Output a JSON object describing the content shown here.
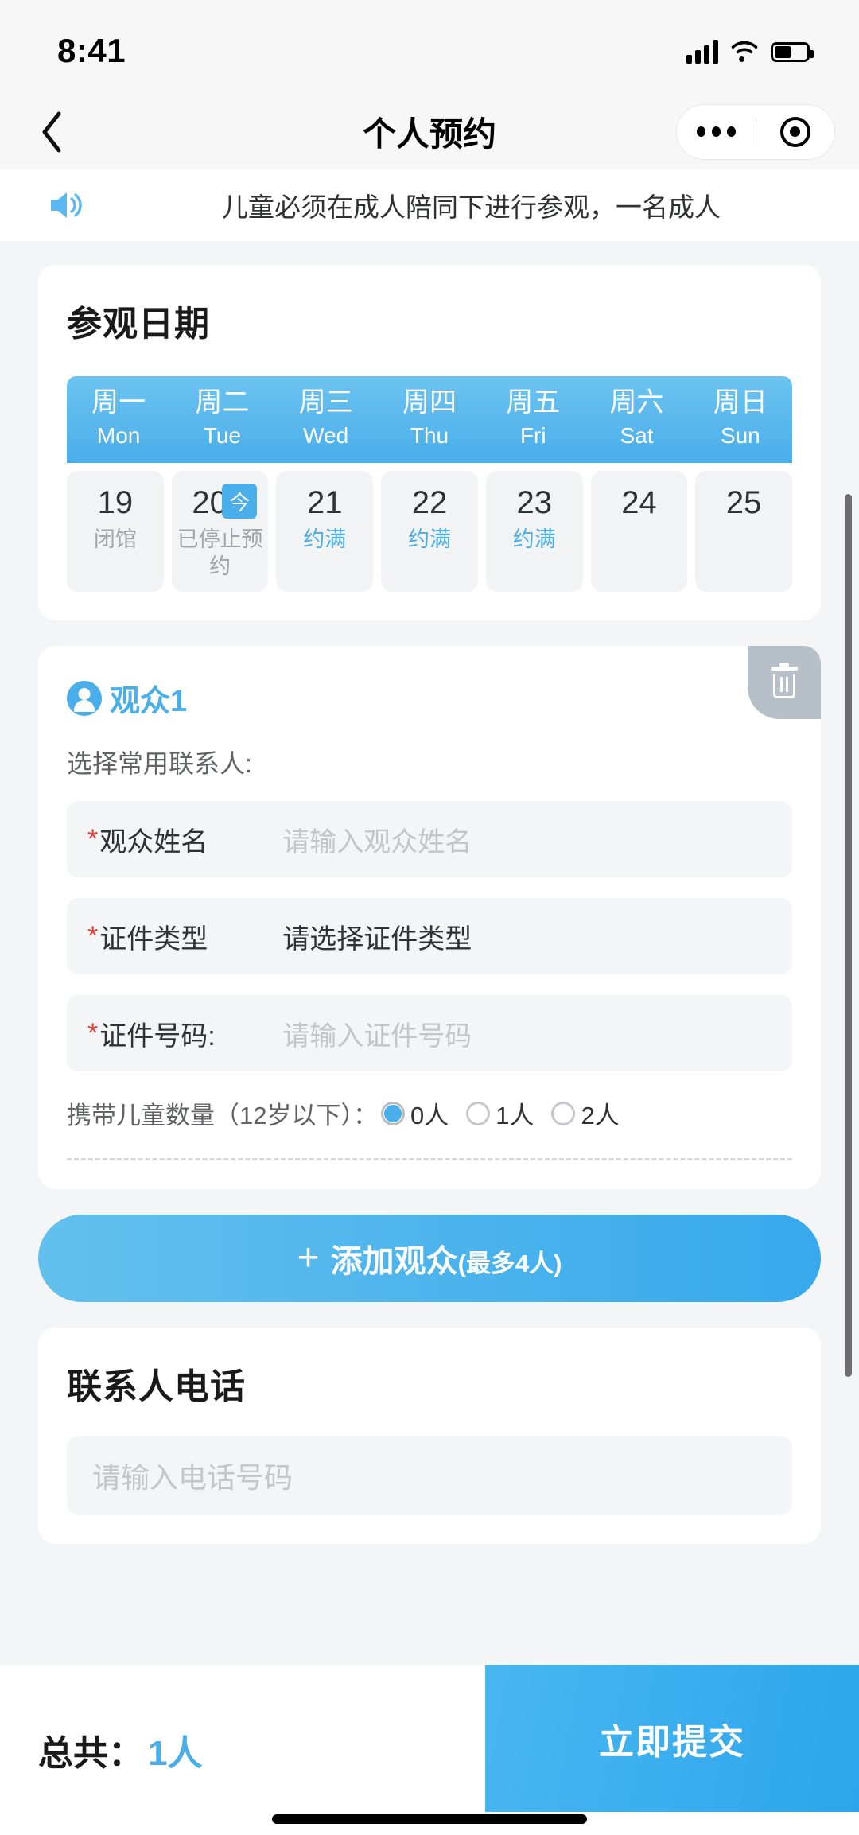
{
  "status_bar": {
    "time": "8:41",
    "icons": [
      "cellular-signal-icon",
      "wifi-icon",
      "battery-icon"
    ]
  },
  "nav": {
    "back_icon": "chevron-left-icon",
    "title": "个人预约",
    "capsule": {
      "more_icon": "more-dots-icon",
      "target_icon": "target-circle-icon"
    }
  },
  "notice": {
    "icon": "speaker-icon",
    "text": "儿童必须在成人陪同下进行参观，一名成人"
  },
  "date_section": {
    "title": "参观日期",
    "weekdays": [
      {
        "cn": "周一",
        "en": "Mon"
      },
      {
        "cn": "周二",
        "en": "Tue"
      },
      {
        "cn": "周三",
        "en": "Wed"
      },
      {
        "cn": "周四",
        "en": "Thu"
      },
      {
        "cn": "周五",
        "en": "Fri"
      },
      {
        "cn": "周六",
        "en": "Sat"
      },
      {
        "cn": "周日",
        "en": "Sun"
      }
    ],
    "days": [
      {
        "num": "19",
        "status": "闭馆",
        "status_type": "closed",
        "badge": ""
      },
      {
        "num": "20",
        "status": "已停止预约",
        "status_type": "closed",
        "badge": "今"
      },
      {
        "num": "21",
        "status": "约满",
        "status_type": "full",
        "badge": ""
      },
      {
        "num": "22",
        "status": "约满",
        "status_type": "full",
        "badge": ""
      },
      {
        "num": "23",
        "status": "约满",
        "status_type": "full",
        "badge": ""
      },
      {
        "num": "24",
        "status": "",
        "status_type": "open",
        "badge": ""
      },
      {
        "num": "25",
        "status": "",
        "status_type": "open",
        "badge": ""
      }
    ]
  },
  "visitor": {
    "avatar_icon": "person-circle-icon",
    "name": "观众1",
    "delete_icon": "trash-icon",
    "contact_picker_label": "选择常用联系人:",
    "fields": [
      {
        "required": "*",
        "label": "观众姓名",
        "placeholder": "请输入观众姓名",
        "value": ""
      },
      {
        "required": "*",
        "label": "证件类型",
        "placeholder": "请选择证件类型",
        "value": ""
      },
      {
        "required": "*",
        "label": "证件号码:",
        "placeholder": "请输入证件号码",
        "value": ""
      }
    ],
    "children": {
      "label": "携带儿童数量（12岁以下）：",
      "options": [
        "0人",
        "1人",
        "2人"
      ],
      "selected": "0人"
    }
  },
  "add_visitor": {
    "plus_icon": "plus-icon",
    "label": "添加观众",
    "hint": "(最多4人)"
  },
  "phone_section": {
    "title": "联系人电话",
    "placeholder": "请输入电话号码",
    "value": ""
  },
  "bottom_bar": {
    "total_label": "总共：",
    "total_value": "1人",
    "submit_label": "立即提交"
  },
  "colors": {
    "accent": "#4aaeea",
    "required": "#e53a33",
    "page_bg": "#f4f5f7",
    "field_bg": "#f4f5f7"
  }
}
